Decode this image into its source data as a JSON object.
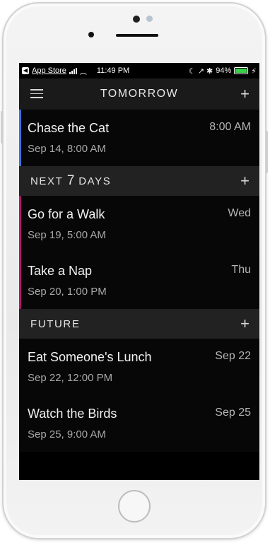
{
  "status_bar": {
    "back_glyph": "◀",
    "back_app": "App Store",
    "wifi_glyph": "︵",
    "time": "11:49 PM",
    "icons": "☾ ↗ ✱",
    "battery": "94%",
    "charge_glyph": "⚡"
  },
  "header": {
    "title": "TOMORROW",
    "menu_icon": "hamburger-icon",
    "add_glyph": "+"
  },
  "tomorrow_items": [
    {
      "title": "Chase the Cat",
      "date": "Sep 14, 8:00 AM",
      "right": "8:00 AM",
      "accent": "#3d6fe0"
    }
  ],
  "sections": {
    "next7": {
      "label_prefix": "NEXT ",
      "label_num": "7",
      "label_suffix": " DAYS",
      "add_glyph": "+"
    },
    "future": {
      "label": "FUTURE",
      "add_glyph": "+"
    }
  },
  "next7_items": [
    {
      "title": "Go for a Walk",
      "date": "Sep 19, 5:00 AM",
      "right": "Wed",
      "accent": "#b0176d"
    },
    {
      "title": "Take a Nap",
      "date": "Sep 20, 1:00 PM",
      "right": "Thu",
      "accent": "#b0176d"
    }
  ],
  "future_items": [
    {
      "title": "Eat Someone's Lunch",
      "date": "Sep 22, 12:00 PM",
      "right": "Sep 22"
    },
    {
      "title": "Watch the Birds",
      "date": "Sep 25, 9:00 AM",
      "right": "Sep 25"
    }
  ],
  "colors": {
    "screen_bg": "#000000",
    "header_bg": "#1a1a1a",
    "section_bg": "#222222",
    "battery_fill": "#39d14b"
  }
}
